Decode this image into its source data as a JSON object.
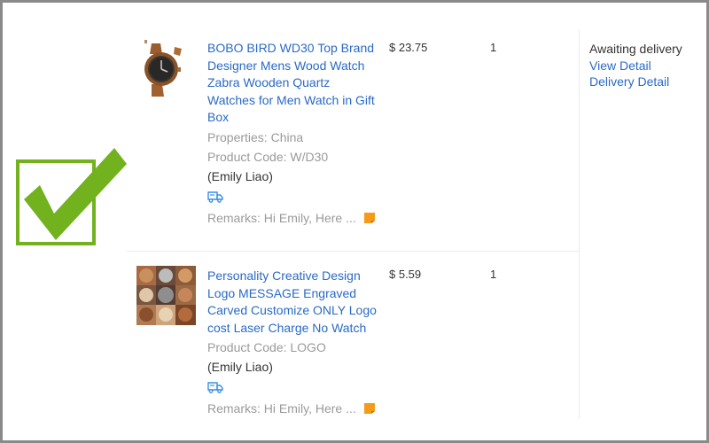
{
  "colors": {
    "link": "#2a6ac6",
    "muted": "#9a9a9a",
    "check": "#71b21e",
    "remark_icon": "#f59b1a"
  },
  "orders": [
    {
      "title": "BOBO BIRD WD30 Top Brand Designer Mens Wood Watch Zabra Wooden Quartz Watches for Men Watch in Gift Box",
      "properties": "Properties: China",
      "product_code": "Product Code: W/D30",
      "buyer": "(Emily Liao)",
      "remarks": "Remarks: Hi Emily, Here ...",
      "price": "$ 23.75",
      "quantity": "1",
      "thumbnail_icon": "wood-watch-image"
    },
    {
      "title": "Personality Creative Design Logo MESSAGE Engraved Carved Customize ONLY Logo cost Laser Charge No Watch",
      "product_code": "Product Code: LOGO",
      "buyer": "(Emily Liao)",
      "remarks": "Remarks: Hi Emily, Here ...",
      "price": "$ 5.59",
      "quantity": "1",
      "thumbnail_icon": "engraved-watch-collage-image"
    }
  ],
  "status": {
    "text": "Awaiting delivery",
    "view_detail": "View Detail",
    "delivery_detail": "Delivery Detail"
  }
}
